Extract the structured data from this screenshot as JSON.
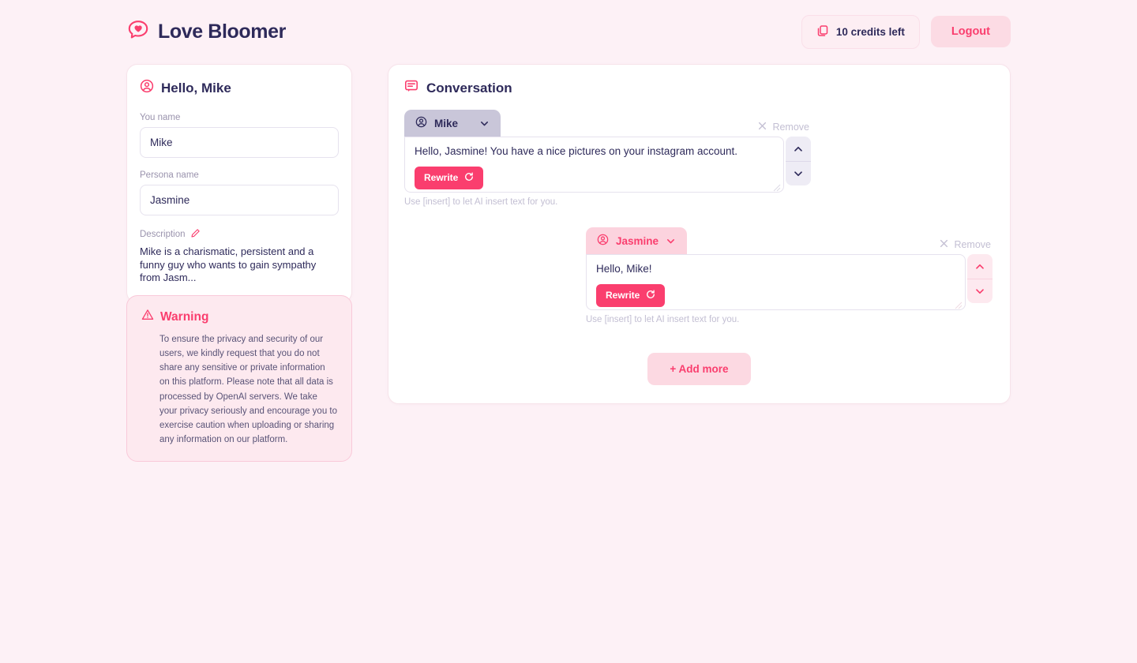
{
  "header": {
    "brand_name": "Love Bloomer",
    "logo_icon": "heart-speech-bubble-icon",
    "credits_label": "10 credits left",
    "credits_icon": "cards-stack-icon",
    "logout_label": "Logout"
  },
  "profile": {
    "title": "Hello, Mike",
    "title_icon": "user-circle-icon",
    "you_name_label": "You name",
    "you_name_value": "Mike",
    "persona_name_label": "Persona name",
    "persona_name_value": "Jasmine",
    "description_label": "Description",
    "description_edit_icon": "pencil-icon",
    "description_value": "Mike is a charismatic, persistent and a funny guy who wants to gain sympathy from Jasm..."
  },
  "warning": {
    "icon": "warning-triangle-icon",
    "title": "Warning",
    "body": "To ensure the privacy and security of our users, we kindly request that you do not share any sensitive or private information on this platform. Please note that all data is processed by OpenAI servers. We take your privacy seriously and encourage you to exercise caution when uploading or sharing any information on our platform."
  },
  "conversation": {
    "title": "Conversation",
    "title_icon": "chat-bubble-icon",
    "remove_label": "Remove",
    "remove_icon": "close-x-icon",
    "rewrite_label": "Rewrite",
    "rewrite_icon": "refresh-icon",
    "move_up_icon": "chevron-up-icon",
    "move_down_icon": "chevron-down-icon",
    "dropdown_icon": "chevron-down-icon",
    "persona_icon": "user-circle-icon",
    "hint": "Use [insert] to let AI insert text for you.",
    "add_more_label": "+ Add more",
    "messages": [
      {
        "speaker": "Mike",
        "text": "Hello, Jasmine! You have a nice pictures on your instagram account."
      },
      {
        "speaker": "Jasmine",
        "text": "Hello, Mike!"
      }
    ]
  },
  "colors": {
    "page_bg": "#fdf1f6",
    "brand_navy": "#2e2a5a",
    "accent_pink": "#fa3e6e",
    "mike_tab": "#c9c6d9",
    "jasmine_tab": "#fcd3de",
    "muted": "#c3bfd3"
  }
}
